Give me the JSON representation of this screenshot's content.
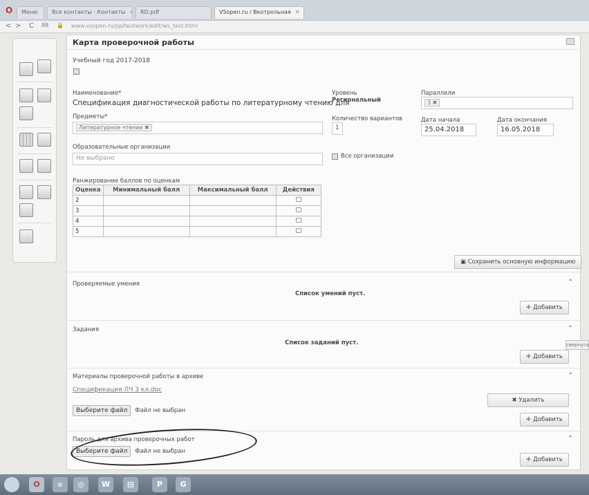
{
  "browser": {
    "tabs": [
      {
        "label": "Меню"
      },
      {
        "label": "Все контакты · Контакты"
      },
      {
        "label": "RD.pdf"
      },
      {
        "label": "VSopen.ru / Вкотрольная"
      }
    ],
    "url": "www.vsopen.ru/pp/testwork/edit/ws_test.html"
  },
  "page": {
    "title": "Карта проверочной работы",
    "academic_year": "Учебный год 2017-2018",
    "name_label": "Наименование*",
    "name_value": "Спецификация диагностической работы по литературному чтению для",
    "subjects_label": "Предметы*",
    "subject_chip": "Литературное чтение",
    "orgs_label": "Образовательные организации",
    "orgs_placeholder": "Не выбрано",
    "level_label": "Уровень",
    "level_value": "Региональный",
    "variants_label": "Количество вариантов",
    "variants_value": "1",
    "parallels_label": "Параллели",
    "parallel_chip": "3",
    "all_orgs_label": "Все организации",
    "start_label": "Дата начала",
    "start_value": "25.04.2018",
    "end_label": "Дата окончания",
    "end_value": "16.05.2018",
    "grades_label": "Ранжирование баллов по оценкам",
    "grades_headers": [
      "Оценка",
      "Минимальный балл",
      "Максимальный балл",
      "Действия"
    ],
    "grades_rows": [
      "2",
      "3",
      "4",
      "5"
    ],
    "save_button": "Сохранить основную информацию",
    "skills_title": "Проверяемые умения",
    "skills_empty": "Список умений пуст.",
    "add_label": "Добавить",
    "tasks_title": "Задания",
    "tasks_empty": "Список заданий пуст.",
    "materials_title": "Материалы проверочной работы в архиве",
    "materials_file": "Спецификация ЛЧ 3 кл.doc",
    "delete_label": "Удалить",
    "choose_file": "Выберите файл",
    "no_file": "Файл не выбран",
    "password_title": "Пароль для архива проверочных работ",
    "side_tip": "свернуть"
  }
}
